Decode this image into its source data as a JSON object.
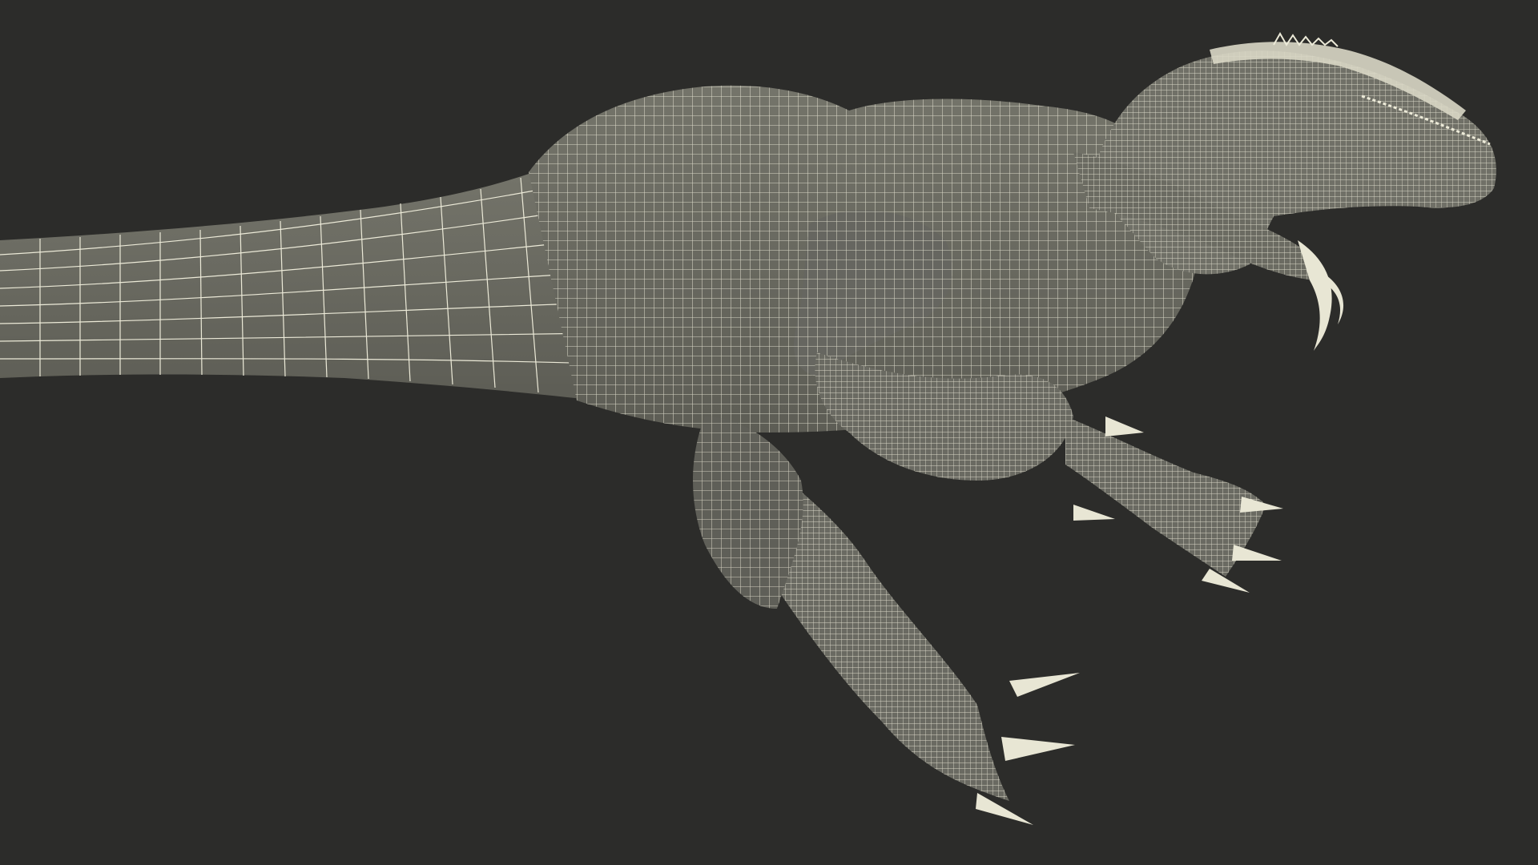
{
  "scene": {
    "background_color": "#2c2c2a",
    "mesh_fill_color": "#6e6e64",
    "mesh_shadow_color": "#55554d",
    "wire_color": "#ecead8",
    "subject": "wireframe-dinosaur-model"
  }
}
